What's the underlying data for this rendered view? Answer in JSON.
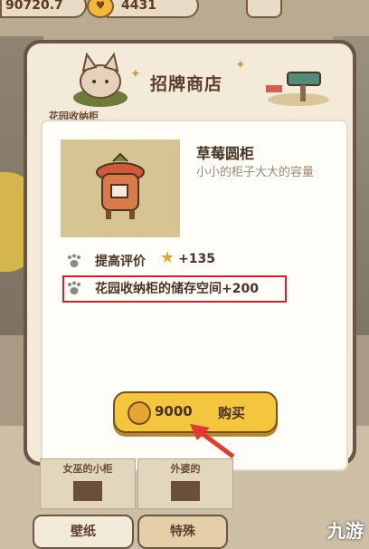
{
  "topbar": {
    "coins": "90720.7",
    "gold": "4431",
    "coin_icon": "coin-icon",
    "gold_icon": "heart-coin-icon"
  },
  "dialog": {
    "title": "招牌商店",
    "side_label": "花园收纳柜"
  },
  "item": {
    "name": "草莓圆柜",
    "description": "小小的柜子大大的容量",
    "attributes": [
      {
        "label": "提高评价",
        "value": "+135",
        "icon": "paw-icon",
        "extra_icon": "star-icon"
      },
      {
        "label": "花园收纳柜的储存空间+200",
        "icon": "paw-icon",
        "highlighted": true
      }
    ]
  },
  "buy": {
    "price": "9000",
    "label": "购买",
    "icon": "coin-icon"
  },
  "bottom": {
    "cards": [
      "女巫的小柜",
      "外婆的"
    ],
    "tabs": [
      "壁纸",
      "特殊"
    ]
  },
  "colors": {
    "accent": "#f3c63e",
    "highlight": "#d6232b",
    "frame": "#6b5646",
    "panel": "#f3ead9"
  },
  "watermark": "九游"
}
